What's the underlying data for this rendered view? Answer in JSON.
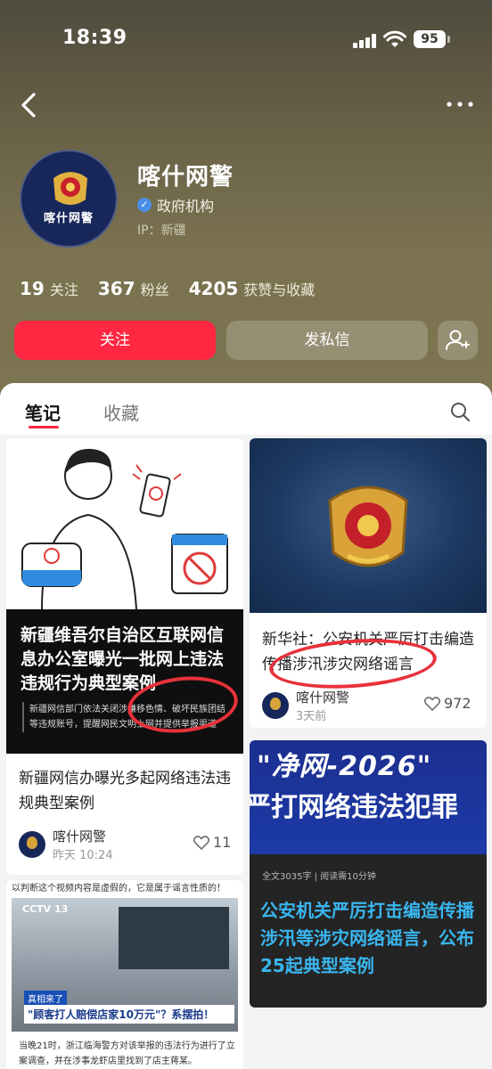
{
  "status_bar": {
    "time": "18:39",
    "battery": "95"
  },
  "profile": {
    "name": "喀什网警",
    "avatar_label": "喀什网警",
    "verification": "政府机构",
    "ip": "IP：新疆",
    "stats": [
      {
        "num": "19",
        "label": "关注"
      },
      {
        "num": "367",
        "label": "粉丝"
      },
      {
        "num": "4205",
        "label": "获赞与收藏"
      }
    ]
  },
  "buttons": {
    "follow": "关注",
    "dm": "发私信"
  },
  "tabs": [
    {
      "label": "笔记",
      "active": true
    },
    {
      "label": "收藏",
      "active": false
    }
  ],
  "cards": {
    "c1": {
      "image_title": "新疆维吾尔自治区互联网信息办公室曝光一批网上违法违规行为典型案例",
      "image_sub": "新疆网信部门依法关闭涉嫌移色情、破坏民族团结等违规账号，提醒网民文明上网并提供举报渠道",
      "title": "新疆网信办曝光多起网络违法违规典型案例",
      "author": "喀什网警",
      "time": "昨天 10:24",
      "likes": "11"
    },
    "c2": {
      "title": "新华社：公安机关严厉打击编造传播涉汛涉灾网络谣言",
      "author": "喀什网警",
      "time": "3天前",
      "likes": "972"
    },
    "c3": {
      "banner_line1": "\"净网-2026\"",
      "banner_line2": "严打网络违法犯罪",
      "meta": "全文3035字 | 阅读需10分钟",
      "headline": "公安机关严厉打击编造传播涉汛等涉灾网络谣言，公布25起典型案例"
    },
    "c4": {
      "top_text": "以判断这个视频内容是虚假的，它是属于谣言性质的！",
      "news_logo": "CCTV 13",
      "ticker": "\"顾客打人赔偿店家10万元\"？系摆拍！",
      "ticker_tag": "真相来了",
      "caption": "当晚21时，浙江临海警方对该举报的违法行为进行了立案调查，并在涉事龙虾店里找到了店主蒋某。"
    }
  },
  "colors": {
    "accent": "#ff2741",
    "verify": "#4a8fe6",
    "headline_blue": "#39b6ef",
    "annotation_red": "#e8313a"
  }
}
